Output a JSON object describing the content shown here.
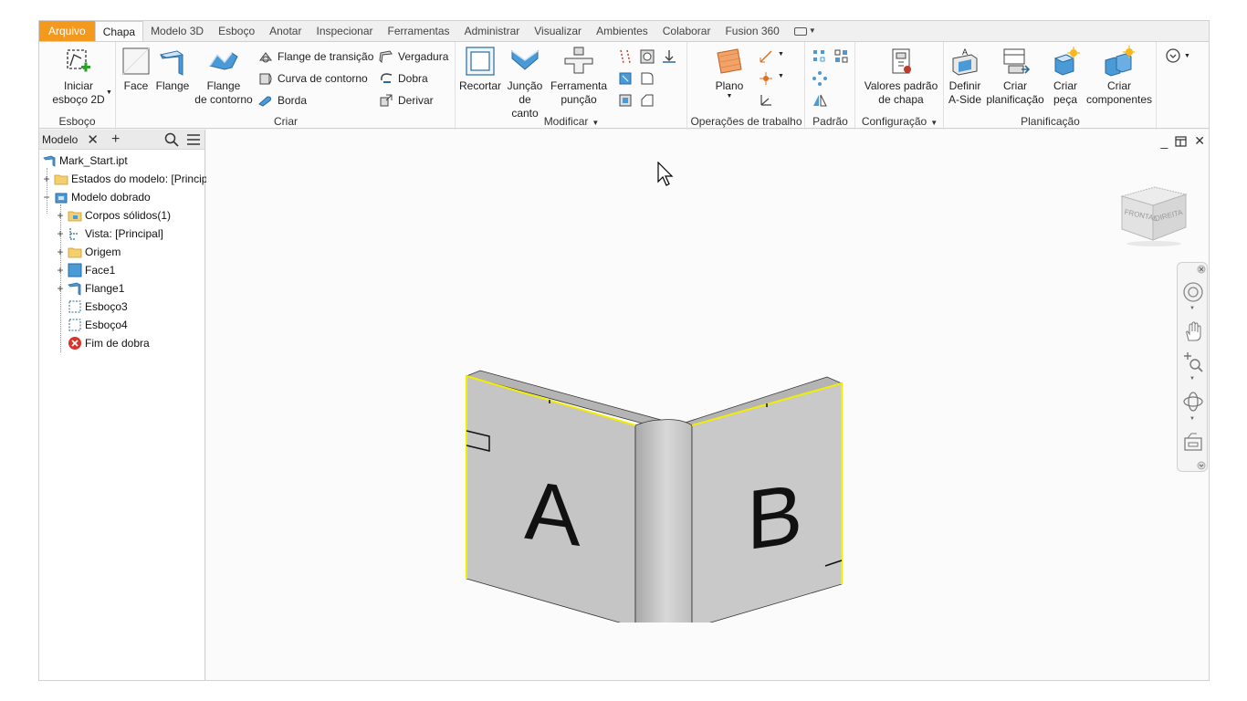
{
  "tabs": [
    "Arquivo",
    "Chapa",
    "Modelo 3D",
    "Esboço",
    "Anotar",
    "Inspecionar",
    "Ferramentas",
    "Administrar",
    "Visualizar",
    "Ambientes",
    "Colaborar",
    "Fusion 360"
  ],
  "active_tab": "Chapa",
  "ribbon": {
    "esboco": {
      "title": "Esboço",
      "start_sketch": "Iniciar\nesboço 2D"
    },
    "criar": {
      "title": "Criar",
      "face": "Face",
      "flange": "Flange",
      "contour_flange": "Flange\nde contorno",
      "transition_flange": "Flange de transição",
      "contour_roll": "Curva de contorno",
      "hem": "Borda",
      "lofted": "Vergadura",
      "fold": "Dobra",
      "derive": "Derivar"
    },
    "modificar": {
      "title": "Modificar",
      "cut": "Recortar",
      "corner_seam": "Junção\nde canto",
      "punch_tool": "Ferramenta\npunção"
    },
    "operacoes": {
      "title": "Operações de trabalho",
      "plane": "Plano"
    },
    "padrao": {
      "title": "Padrão"
    },
    "configuracao": {
      "title": "Configuração",
      "defaults": "Valores padrão\nde chapa"
    },
    "planificacao": {
      "title": "Planificação",
      "define_aside": "Definir\nA-Side",
      "create_flat": "Criar\nplanificação",
      "create_part": "Criar\npeça",
      "create_components": "Criar\ncomponentes"
    }
  },
  "browser": {
    "tab_label": "Modelo",
    "items": [
      {
        "label": "Mark_Start.ipt"
      },
      {
        "label": "Estados do modelo: [Principal]"
      },
      {
        "label": "Modelo dobrado"
      },
      {
        "label": "Corpos sólidos(1)"
      },
      {
        "label": "Vista: [Principal]"
      },
      {
        "label": "Origem"
      },
      {
        "label": "Face1"
      },
      {
        "label": "Flange1"
      },
      {
        "label": "Esboço3"
      },
      {
        "label": "Esboço4"
      },
      {
        "label": "Fim de dobra"
      }
    ]
  },
  "viewcube": {
    "front": "FRONTAL",
    "right": "DIREITA"
  },
  "model": {
    "mark_left": "A",
    "mark_right": "B"
  },
  "colors": {
    "file_tab": "#f39a1e",
    "edge_highlight": "#f2ee00",
    "sheet_face": "#c5c5c5",
    "accent_blue": "#3a8fd8"
  }
}
